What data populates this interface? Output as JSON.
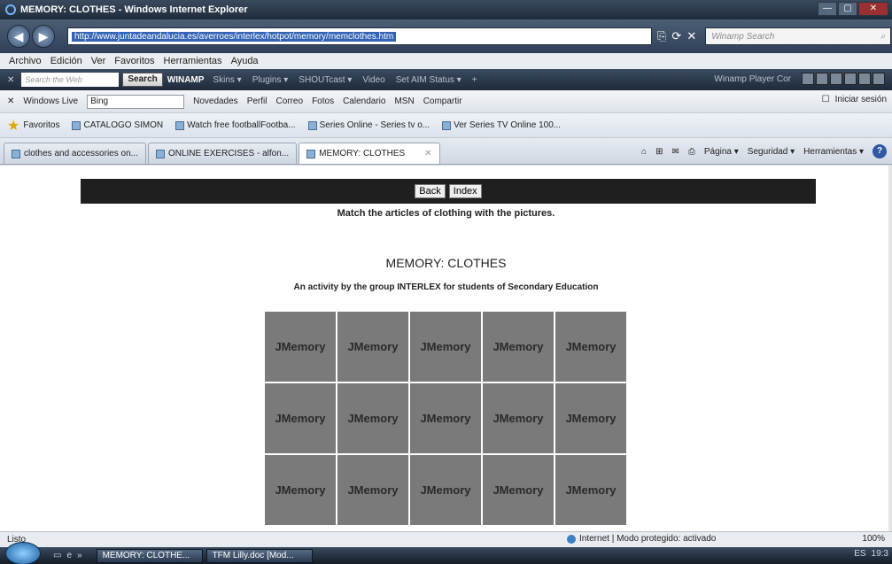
{
  "window": {
    "title": "MEMORY: CLOTHES - Windows Internet Explorer",
    "controls": [
      "—",
      "▢",
      "✕"
    ]
  },
  "address_bar": {
    "url": "http://www.juntadeandalucia.es/averroes/interlex/hotpot/memory/memclothes.htm",
    "search_placeholder": "Winamp Search"
  },
  "menu": [
    "Archivo",
    "Edición",
    "Ver",
    "Favoritos",
    "Herramientas",
    "Ayuda"
  ],
  "winamp_toolbar": {
    "search_placeholder": "Search the Web",
    "search_button": "Search",
    "brand": "WINAMP",
    "items": [
      "Skins ▾",
      "Plugins ▾",
      "SHOUTcast ▾",
      "Video",
      "Set AIM Status ▾",
      "+"
    ],
    "player_label": "Winamp Player Cor"
  },
  "live_toolbar": {
    "brand": "Windows Live",
    "search_value": "Bing",
    "items": [
      "Novedades",
      "Perfil",
      "Correo",
      "Fotos",
      "Calendario",
      "MSN",
      "Compartir"
    ],
    "signin": "Iniciar sesión"
  },
  "favorites_bar": {
    "favorites_label": "Favoritos",
    "links": [
      "CATALOGO SIMON",
      "Watch free footballFootba...",
      "Series Online - Series tv o...",
      "Ver Series TV Online 100..."
    ]
  },
  "tabs": [
    {
      "label": "clothes and accessories on...",
      "active": false
    },
    {
      "label": "ONLINE EXERCISES - alfon...",
      "active": false
    },
    {
      "label": "MEMORY: CLOTHES",
      "active": true
    }
  ],
  "command_bar": [
    "Página ▾",
    "Seguridad ▾",
    "Herramientas ▾"
  ],
  "page": {
    "nav_buttons": {
      "back": "Back",
      "index": "Index"
    },
    "instructions": "Match the articles of clothing with the pictures.",
    "title": "MEMORY: CLOTHES",
    "subtitle": "An activity by the group INTERLEX for students of Secondary Education",
    "card_label": "JMemory",
    "grid_columns": 5,
    "grid_rows_visible": 3
  },
  "status_bar": {
    "left": "Listo",
    "zone": "Internet | Modo protegido: activado",
    "zoom": "100%"
  },
  "taskbar": {
    "buttons": [
      "MEMORY: CLOTHE...",
      "TFM Lilly.doc [Mod..."
    ],
    "tray": [
      "ES",
      "19:3"
    ]
  }
}
